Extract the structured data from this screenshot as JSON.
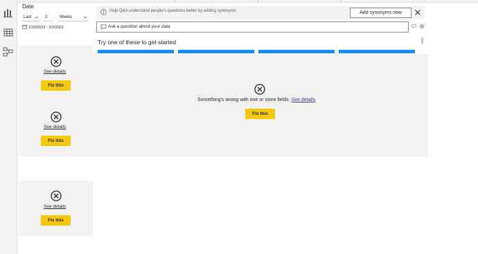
{
  "slicer": {
    "title": "Date",
    "period_select": "Last",
    "count": "2",
    "unit_select": "Weeks",
    "date_range": "1/20/2022 - 2/2/2022"
  },
  "error_visual": {
    "see_details": "See details",
    "fix_this": "Fix this"
  },
  "qa": {
    "banner_text": "Help Q&A understand people's questions better by adding synonyms.",
    "add_synonyms_button": "Add synonyms now",
    "input_placeholder": "Ask a question about your data",
    "suggestions_title": "Try one of these to get started",
    "error_message": "Something's wrong with one or more fields.",
    "see_details": "See details",
    "fix_this": "Fix this"
  },
  "colors": {
    "accent_yellow": "#f2c811",
    "suggestion_blue": "#118dff",
    "panel_gray": "#f3f2f1"
  },
  "icons": [
    "report-view-icon",
    "table-view-icon",
    "model-view-icon",
    "info-icon",
    "close-icon",
    "chat-icon",
    "calendar-icon",
    "error-circle-icon",
    "chevron-down-icon",
    "settings-icon",
    "ask-feedback-icon"
  ]
}
